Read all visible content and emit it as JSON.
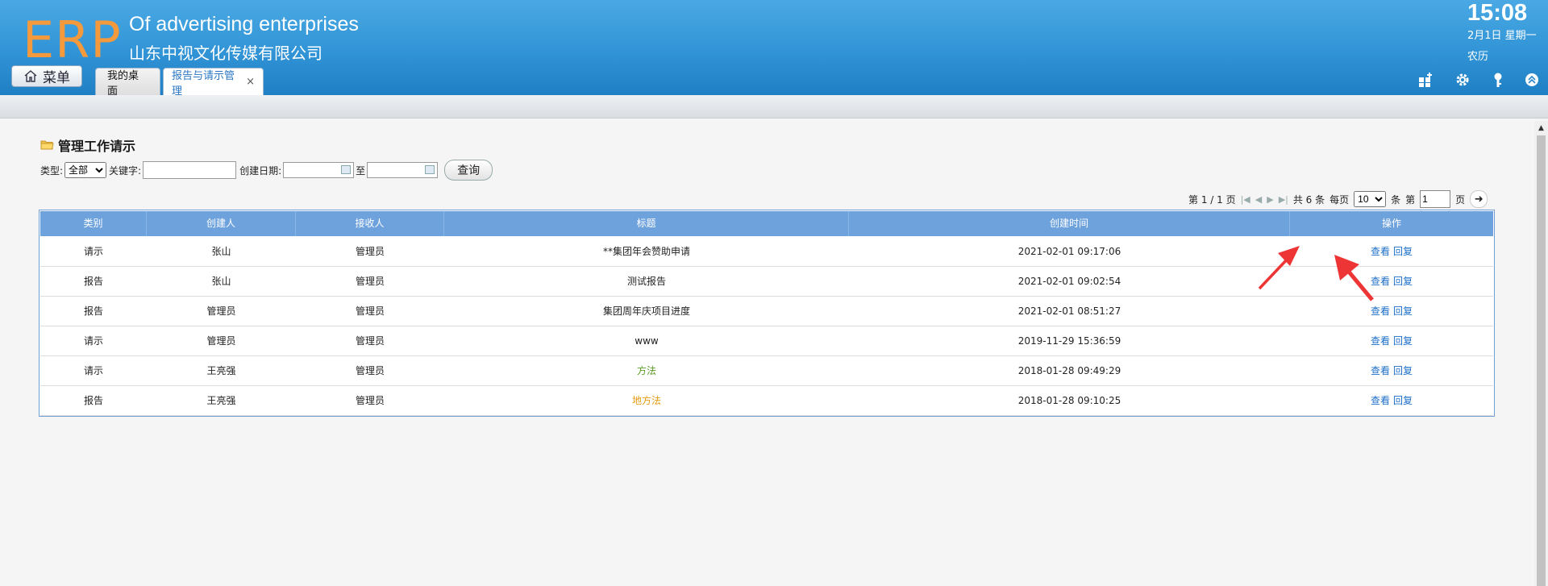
{
  "header": {
    "logo": "ERP",
    "company_en": "Of advertising enterprises",
    "company_cn": "山东中视文化传媒有限公司",
    "clock": "15:08",
    "date": "2月1日 星期一",
    "lunar": "农历",
    "menu_label": "菜单",
    "tabs": [
      {
        "label": "我的桌面"
      },
      {
        "label": "报告与请示管理",
        "close": "×"
      }
    ],
    "icons": [
      "add-widget-icon",
      "settings-icon",
      "key-icon",
      "collapse-icon"
    ]
  },
  "page": {
    "title": "管理工作请示",
    "filters": {
      "type_label": "类型:",
      "type_value": "全部",
      "keyword_label": "关键字:",
      "created_label": "创建日期:",
      "to_label": "至",
      "query_button": "查询"
    },
    "pager": {
      "page_info": "第 1 / 1 页",
      "total": "共 6 条",
      "per_page_label": "每页",
      "per_page_value": "10",
      "unit": "条",
      "goto_label": "第",
      "goto_value": "1",
      "page_unit": "页"
    }
  },
  "table": {
    "headers": [
      "类别",
      "创建人",
      "接收人",
      "标题",
      "创建时间",
      "操作"
    ],
    "rows": [
      {
        "type": "请示",
        "creator": "张山",
        "receiver": "管理员",
        "title": "**集团年会赞助申请",
        "time": "2021-02-01 09:17:06",
        "view": "查看",
        "reply": "回复"
      },
      {
        "type": "报告",
        "creator": "张山",
        "receiver": "管理员",
        "title": "测试报告",
        "time": "2021-02-01 09:02:54",
        "view": "查看",
        "reply": "回复"
      },
      {
        "type": "报告",
        "creator": "管理员",
        "receiver": "管理员",
        "title": "集团周年庆项目进度",
        "time": "2021-02-01 08:51:27",
        "view": "查看",
        "reply": "回复"
      },
      {
        "type": "请示",
        "creator": "管理员",
        "receiver": "管理员",
        "title": "www",
        "time": "2019-11-29 15:36:59",
        "view": "查看",
        "reply": "回复"
      },
      {
        "type": "请示",
        "creator": "王亮强",
        "receiver": "管理员",
        "title": "方法",
        "time": "2018-01-28 09:49:29",
        "view": "查看",
        "reply": "回复"
      },
      {
        "type": "报告",
        "creator": "王亮强",
        "receiver": "管理员",
        "title": "地方法",
        "time": "2018-01-28 09:10:25",
        "view": "查看",
        "reply": "回复"
      }
    ]
  },
  "colors": {
    "header_blue": "#3194d6",
    "logo_orange": "#f59a3c",
    "table_head": "#6ea2dd",
    "link_blue": "#1d6fc9",
    "title_green": "#5a9a22",
    "title_orange": "#e69a10",
    "annotation_red": "#ee3535"
  }
}
